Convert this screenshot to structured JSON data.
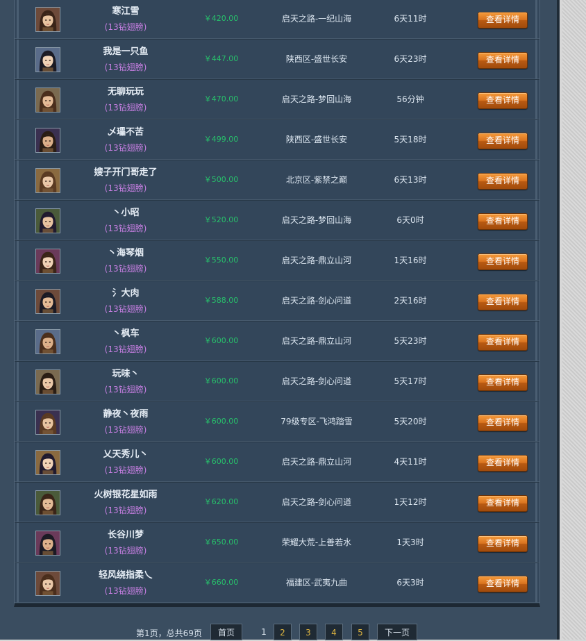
{
  "rows": [
    {
      "name": "寒江雪",
      "tag": "(13钻翅膀)",
      "price": "￥420.00",
      "server": "启天之路-一纪山海",
      "time": "6天11时",
      "action": "查看详情"
    },
    {
      "name": "我是一只鱼",
      "tag": "(13钻翅膀)",
      "price": "￥447.00",
      "server": "陕西区-盛世长安",
      "time": "6天23时",
      "action": "查看详情"
    },
    {
      "name": "无聊玩玩",
      "tag": "(13钻翅膀)",
      "price": "￥470.00",
      "server": "启天之路-梦回山海",
      "time": "56分钟",
      "action": "查看详情"
    },
    {
      "name": "乄瓃不苦",
      "tag": "(13钻翅膀)",
      "price": "￥499.00",
      "server": "陕西区-盛世长安",
      "time": "5天18时",
      "action": "查看详情"
    },
    {
      "name": "嫂子开门哥走了",
      "tag": "(13钻翅膀)",
      "price": "￥500.00",
      "server": "北京区-紫禁之巅",
      "time": "6天13时",
      "action": "查看详情"
    },
    {
      "name": "丶小昭",
      "tag": "(13钻翅膀)",
      "price": "￥520.00",
      "server": "启天之路-梦回山海",
      "time": "6天0时",
      "action": "查看详情"
    },
    {
      "name": "丶海琴烟",
      "tag": "(13钻翅膀)",
      "price": "￥550.00",
      "server": "启天之路-鼎立山河",
      "time": "1天16时",
      "action": "查看详情"
    },
    {
      "name": "氵大肉",
      "tag": "(13钻翅膀)",
      "price": "￥588.00",
      "server": "启天之路-剑心问道",
      "time": "2天16时",
      "action": "查看详情"
    },
    {
      "name": "丶枫车",
      "tag": "(13钻翅膀)",
      "price": "￥600.00",
      "server": "启天之路-鼎立山河",
      "time": "5天23时",
      "action": "查看详情"
    },
    {
      "name": "玩味丶",
      "tag": "(13钻翅膀)",
      "price": "￥600.00",
      "server": "启天之路-剑心问道",
      "time": "5天17时",
      "action": "查看详情"
    },
    {
      "name": "静夜丶夜雨",
      "tag": "(13钻翅膀)",
      "price": "￥600.00",
      "server": "79级专区-飞鸿踏雪",
      "time": "5天20时",
      "action": "查看详情"
    },
    {
      "name": "乂天秀儿丶",
      "tag": "(13钻翅膀)",
      "price": "￥600.00",
      "server": "启天之路-鼎立山河",
      "time": "4天11时",
      "action": "查看详情"
    },
    {
      "name": "火树银花星如雨",
      "tag": "(13钻翅膀)",
      "price": "￥620.00",
      "server": "启天之路-剑心问道",
      "time": "1天12时",
      "action": "查看详情"
    },
    {
      "name": "长谷川梦",
      "tag": "(13钻翅膀)",
      "price": "￥650.00",
      "server": "荣耀大荒-上善若水",
      "time": "1天3时",
      "action": "查看详情"
    },
    {
      "name": "轻风绕指柔乀",
      "tag": "(13钻翅膀)",
      "price": "￥660.00",
      "server": "福建区-武夷九曲",
      "time": "6天3时",
      "action": "查看详情"
    }
  ],
  "pager": {
    "info": "第1页，总共69页",
    "first": "首页",
    "current": "1",
    "pages": [
      "2",
      "3",
      "4",
      "5"
    ],
    "next": "下一页"
  },
  "colors": {
    "panel": "#33465a",
    "price": "#27c26b",
    "tag": "#c77fe3",
    "button": "#d9731f",
    "page_number": "#e0b640"
  }
}
